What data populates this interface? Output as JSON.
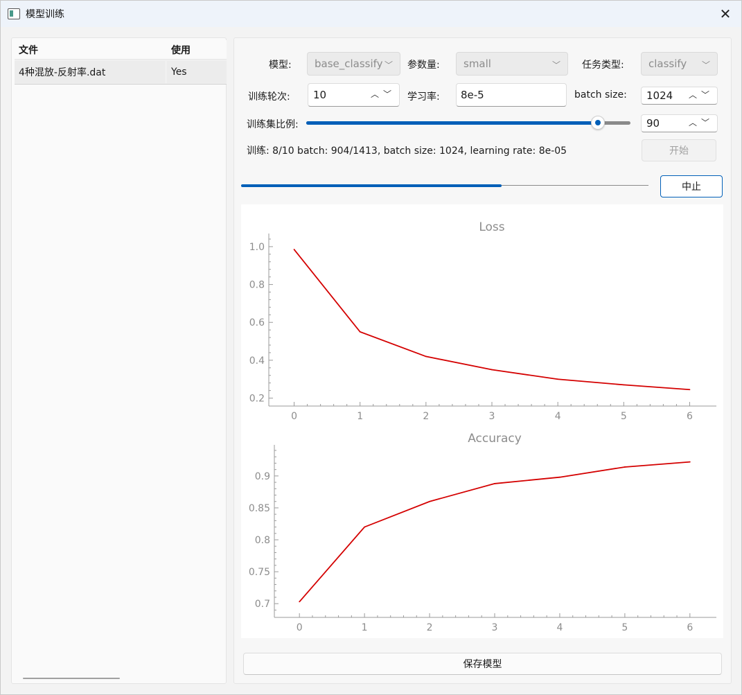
{
  "window": {
    "title": "模型训练",
    "close_icon": "close-icon"
  },
  "file_table": {
    "headers": [
      "文件",
      "使用"
    ],
    "rows": [
      {
        "file": "4种混放-反射率.dat",
        "use": "Yes"
      }
    ]
  },
  "settings": {
    "model_label": "模型:",
    "model_value": "base_classify",
    "params_label": "参数量:",
    "params_value": "small",
    "task_label": "任务类型:",
    "task_value": "classify",
    "epochs_label": "训练轮次:",
    "epochs_value": "10",
    "lr_label": "学习率:",
    "lr_value": "8e-5",
    "batch_label": "batch size:",
    "batch_value": "1024",
    "ratio_label": "训练集比例:",
    "ratio_value": "90",
    "ratio_slider": {
      "value": 90,
      "min": 0,
      "max": 100
    }
  },
  "status": {
    "text": "训练: 8/10 batch: 904/1413, batch size: 1024, learning rate: 8e-05",
    "progress": 0.64
  },
  "buttons": {
    "start": "开始",
    "stop": "中止",
    "save": "保存模型"
  },
  "colors": {
    "accent": "#005fb8",
    "line": "#d40000",
    "axis_text": "#8c8c8c"
  },
  "chart_data": [
    {
      "type": "line",
      "title": "Loss",
      "x": [
        0,
        1,
        2,
        3,
        4,
        5,
        6
      ],
      "series": [
        {
          "values": [
            0.985,
            0.55,
            0.42,
            0.35,
            0.3,
            0.27,
            0.245
          ]
        }
      ],
      "xticks": [
        "0",
        "1",
        "2",
        "3",
        "4",
        "5",
        "6"
      ],
      "yticks": [
        "0.2",
        "0.4",
        "0.6",
        "0.8",
        "1.0"
      ],
      "xlim": [
        -0.3,
        6.3
      ],
      "ylim": [
        0.18,
        1.04
      ],
      "grid": false,
      "legend": "none"
    },
    {
      "type": "line",
      "title": "Accuracy",
      "x": [
        0,
        1,
        2,
        3,
        4,
        5,
        6
      ],
      "series": [
        {
          "values": [
            0.703,
            0.82,
            0.86,
            0.888,
            0.898,
            0.914,
            0.922
          ]
        }
      ],
      "xticks": [
        "0",
        "1",
        "2",
        "3",
        "4",
        "5",
        "6"
      ],
      "yticks": [
        "0.7",
        "0.75",
        "0.8",
        "0.85",
        "0.9"
      ],
      "xlim": [
        -0.3,
        6.3
      ],
      "ylim": [
        0.685,
        0.94
      ],
      "grid": false,
      "legend": "none"
    }
  ]
}
